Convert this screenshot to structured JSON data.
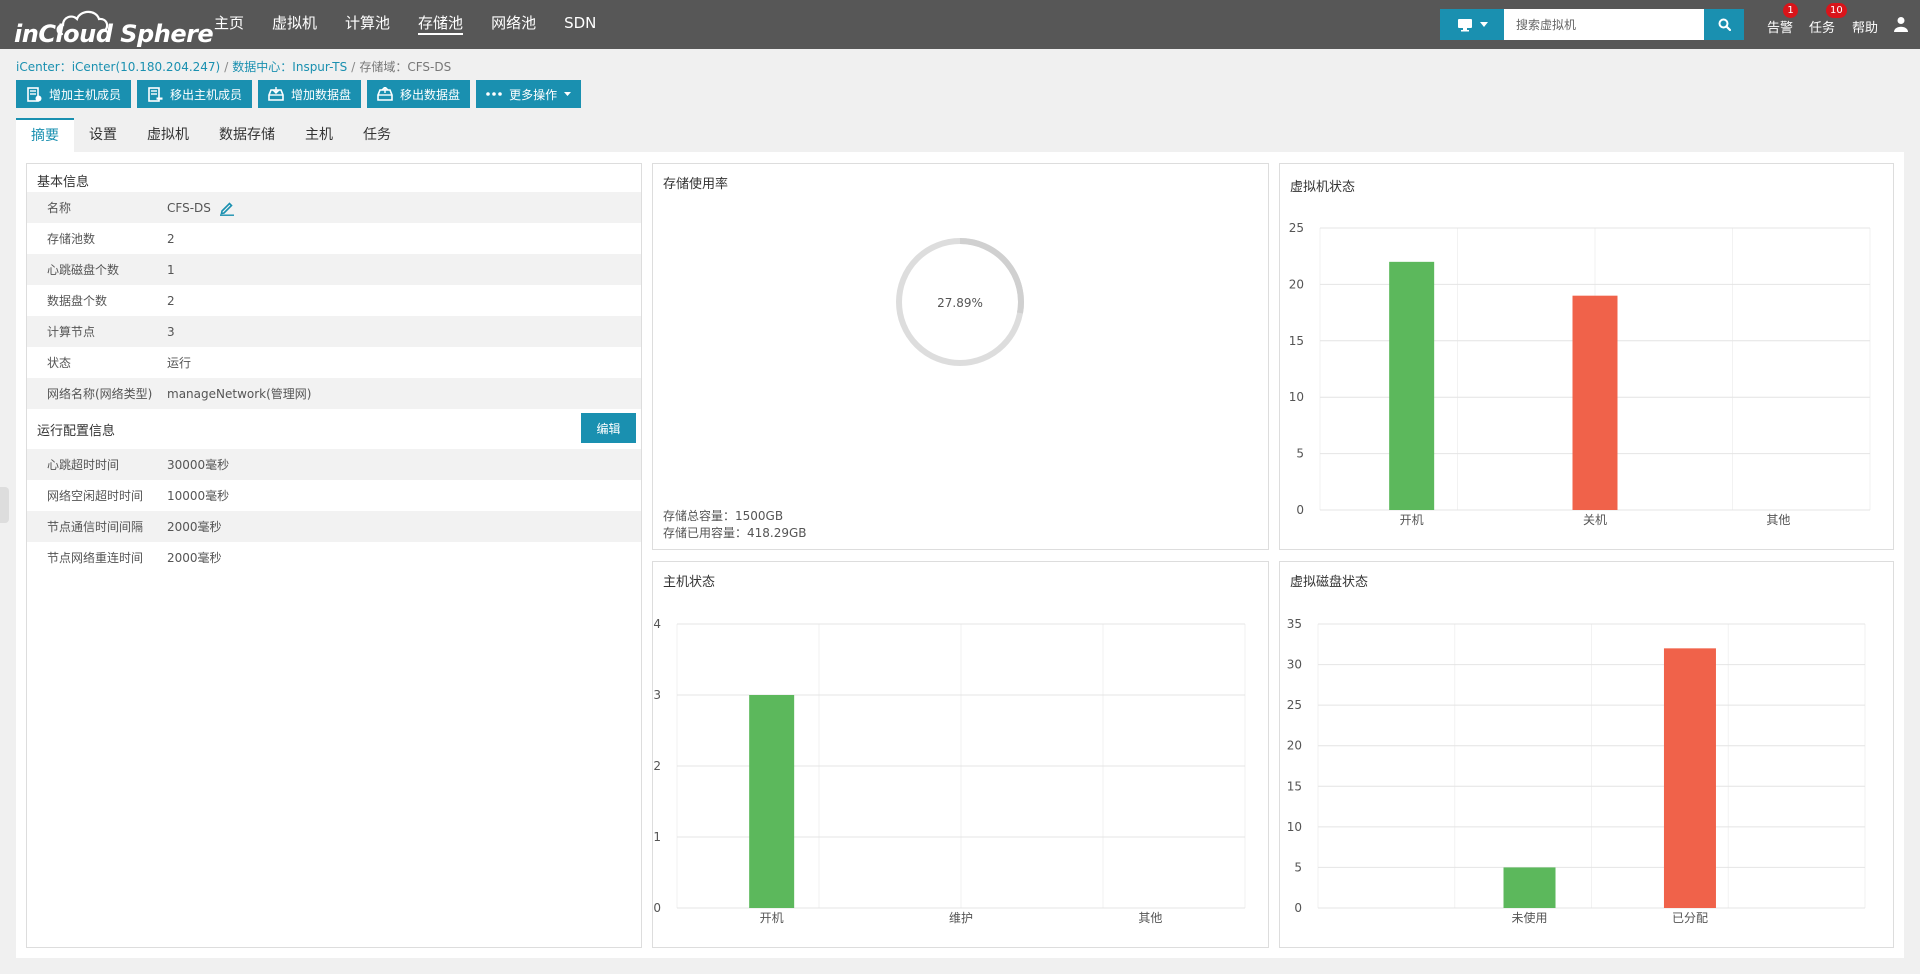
{
  "brand": {
    "name": "inCloud Sphere"
  },
  "nav": [
    {
      "label": "主页",
      "active": false
    },
    {
      "label": "虚拟机",
      "active": false
    },
    {
      "label": "计算池",
      "active": false
    },
    {
      "label": "存储池",
      "active": true
    },
    {
      "label": "网络池",
      "active": false
    },
    {
      "label": "SDN",
      "active": false
    }
  ],
  "search": {
    "placeholder": "搜索虚拟机"
  },
  "top_links": {
    "alarm": {
      "label": "告警",
      "badge": "1"
    },
    "task": {
      "label": "任务",
      "badge": "10"
    },
    "help": {
      "label": "帮助"
    }
  },
  "breadcrumb": {
    "icenter": "iCenter：iCenter(10.180.204.247)",
    "datacenter": "数据中心：Inspur-TS",
    "current": "存储域：CFS-DS"
  },
  "actions": [
    {
      "label": "增加主机成员",
      "icon": "add-host-icon"
    },
    {
      "label": "移出主机成员",
      "icon": "remove-host-icon"
    },
    {
      "label": "增加数据盘",
      "icon": "add-disk-icon"
    },
    {
      "label": "移出数据盘",
      "icon": "remove-disk-icon"
    },
    {
      "label": "更多操作",
      "icon": "more-icon"
    }
  ],
  "tabs": [
    {
      "label": "摘要",
      "active": true
    },
    {
      "label": "设置",
      "active": false
    },
    {
      "label": "虚拟机",
      "active": false
    },
    {
      "label": "数据存储",
      "active": false
    },
    {
      "label": "主机",
      "active": false
    },
    {
      "label": "任务",
      "active": false
    }
  ],
  "basic_info": {
    "title": "基本信息",
    "rows": [
      {
        "key": "名称",
        "value": "CFS-DS"
      },
      {
        "key": "存储池数",
        "value": "2"
      },
      {
        "key": "心跳磁盘个数",
        "value": "1"
      },
      {
        "key": "数据盘个数",
        "value": "2"
      },
      {
        "key": "计算节点",
        "value": "3"
      },
      {
        "key": "状态",
        "value": "运行"
      },
      {
        "key": "网络名称(网络类型)",
        "value": "manageNetwork(管理网)"
      }
    ]
  },
  "runtime_config": {
    "title": "运行配置信息",
    "edit_label": "编辑",
    "rows": [
      {
        "key": "心跳超时时间",
        "value": "30000毫秒"
      },
      {
        "key": "网络空闲超时时间",
        "value": "10000毫秒"
      },
      {
        "key": "节点通信时间间隔",
        "value": "2000毫秒"
      },
      {
        "key": "节点网络重连时间",
        "value": "2000毫秒"
      }
    ]
  },
  "storage_usage": {
    "title": "存储使用率",
    "percent_label": "27.89%",
    "total_label": "存储总容量：1500GB",
    "used_label": "存储已用容量：418.29GB"
  },
  "colors": {
    "accent": "#1a90b0",
    "green": "#5cb85c",
    "red": "#f0624a",
    "ring": "#dddddd"
  },
  "chart_data": [
    {
      "type": "bar",
      "title": "虚拟机状态",
      "categories": [
        "开机",
        "关机",
        "其他"
      ],
      "values": [
        22,
        19,
        0
      ],
      "bar_colors": [
        "#5cb85c",
        "#f0624a",
        "#5cb85c"
      ],
      "yticks": [
        0,
        5,
        10,
        15,
        20,
        25
      ],
      "ylim": [
        0,
        25
      ]
    },
    {
      "type": "bar",
      "title": "主机状态",
      "categories": [
        "开机",
        "维护",
        "其他"
      ],
      "values": [
        3,
        0,
        0
      ],
      "bar_colors": [
        "#5cb85c",
        "#f0624a",
        "#5cb85c"
      ],
      "yticks": [
        0,
        1,
        2,
        3,
        4
      ],
      "ylim": [
        0,
        4
      ]
    },
    {
      "type": "bar",
      "title": "虚拟磁盘状态",
      "categories": [
        "未使用",
        "已分配"
      ],
      "values": [
        5,
        32
      ],
      "bar_colors": [
        "#5cb85c",
        "#f0624a"
      ],
      "yticks": [
        0,
        5,
        10,
        15,
        20,
        25,
        30,
        35
      ],
      "ylim": [
        0,
        35
      ]
    }
  ]
}
